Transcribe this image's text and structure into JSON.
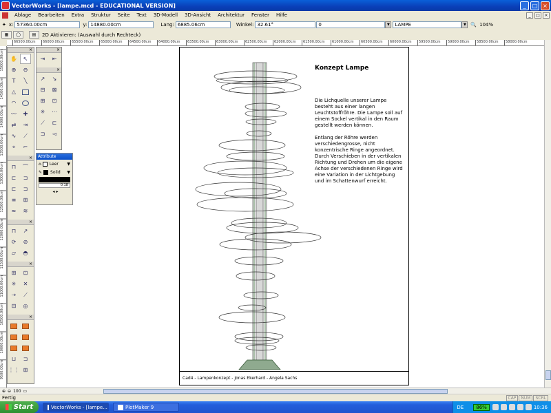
{
  "window": {
    "title": "VectorWorks - [lampe.mcd - EDUCATIONAL VERSION]",
    "controls": {
      "minimize": "_",
      "maximize": "□",
      "close": "×"
    }
  },
  "menubar": {
    "items": [
      "Ablage",
      "Bearbeiten",
      "Extra",
      "Struktur",
      "Seite",
      "Text",
      "3D-Modell",
      "3D-Ansicht",
      "Architektur",
      "Fenster",
      "Hilfe"
    ]
  },
  "databar": {
    "x_label": "x:",
    "x_value": "57360.00cm",
    "y_label": "y:",
    "y_value": "14880.00cm",
    "length_label": "Lang:",
    "length_value": "6885.06cm",
    "angle_label": "Winkel:",
    "angle_value": "32.61°",
    "field5_value": "0",
    "layer_value": "LAMPE",
    "zoom_value": "104%"
  },
  "modebar": {
    "hint": "2D Aktivieren: (Auswahl durch Rechteck)"
  },
  "ruler": {
    "h_ticks": [
      "66500.00cm",
      "66000.00cm",
      "65500.00cm",
      "65000.00cm",
      "64500.00cm",
      "64000.00cm",
      "63500.00cm",
      "63000.00cm",
      "62500.00cm",
      "62000.00cm",
      "61500.00cm",
      "61000.00cm",
      "60500.00cm",
      "60000.00cm",
      "59500.00cm",
      "59000.00cm",
      "58500.00cm",
      "58000.00cm"
    ],
    "v_ticks": [
      "15000.00cm",
      "14500.00cm",
      "14000.00cm",
      "13500.00cm",
      "13000.00cm",
      "12500.00cm",
      "12000.00cm",
      "11500.00cm",
      "11000.00cm",
      "10500.00cm",
      "10000.00cm",
      "9500.00cm"
    ]
  },
  "sheet": {
    "title": "Konzept Lampe",
    "paragraph1": "Die Lichquelle unserer Lampe besteht aus einer langen Leuchtstoffröhre. Die Lampe soll auf einem Sockel vertikal in den Raum gestellt werden können.",
    "paragraph2": "Entlang der Röhre werden verschiedengrosse, nicht konzentrische Ringe angeordnet. Durch Verschieben in der vertikalen Richtung und Drehen um die eigene Achse der verschiedenen Ringe wird eine Variation in der Lichtgebung und im Schattenwurf erreicht.",
    "footer": "Cad4 - Lampenkonzept - Jonas Ekerhard - Angela Sachs"
  },
  "attributes": {
    "title": "Attribute",
    "fill_label": "Leer",
    "pen_label": "Solid",
    "line_weight": "0.18"
  },
  "statusbar": {
    "text": "Fertig",
    "zoom_ctl": "100",
    "keys": [
      "CAP",
      "NUM",
      "SCRL"
    ]
  },
  "taskbar": {
    "start_label": "Start",
    "tasks": [
      "VectorWorks - [lampe...",
      "PlotMaker 9"
    ],
    "lang": "DE",
    "battery": "86%",
    "clock": "10:36"
  }
}
